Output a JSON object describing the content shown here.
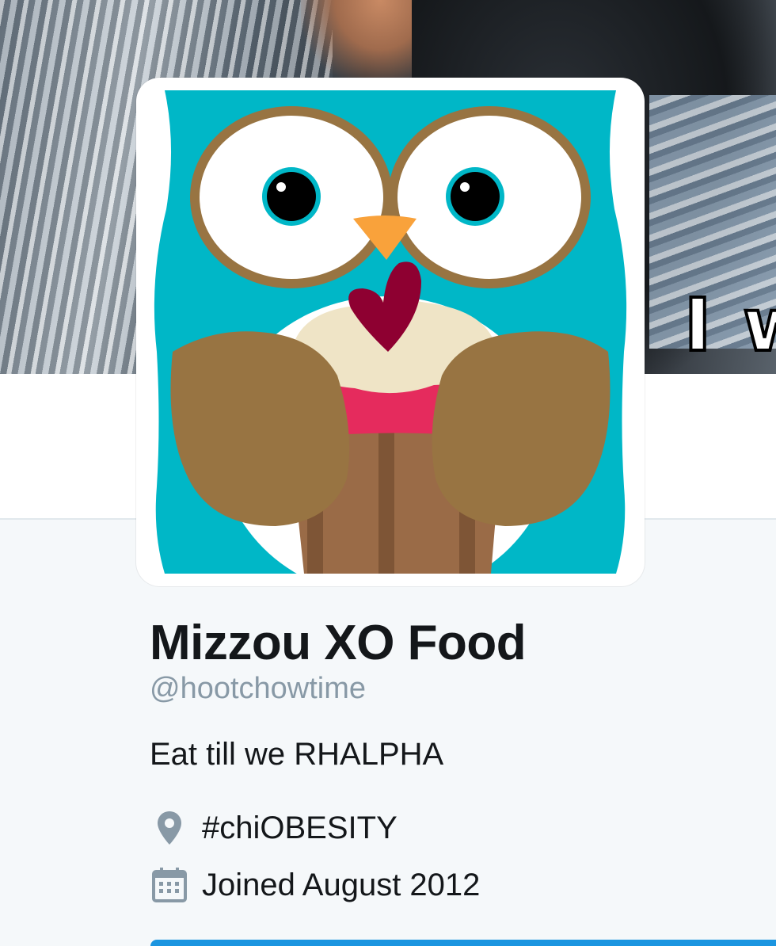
{
  "banner": {
    "overlay_text": "I w"
  },
  "profile": {
    "name": "Mizzou XO Food",
    "handle": "@hootchowtime",
    "bio": "Eat till we RHALPHA",
    "location": "#chiOBESITY",
    "joined": "Joined August 2012"
  },
  "icons": {
    "location": "location-pin-icon",
    "joined": "calendar-icon"
  },
  "colors": {
    "text_primary": "#14171a",
    "text_secondary": "#8899a6",
    "icon_gray": "#8899a6",
    "page_bg": "#f5f8fa",
    "accent": "#1b95e0",
    "owl_teal": "#00b7c7",
    "owl_brown": "#987442",
    "cupcake_pink": "#e52b5d",
    "heart_maroon": "#8e0031"
  }
}
